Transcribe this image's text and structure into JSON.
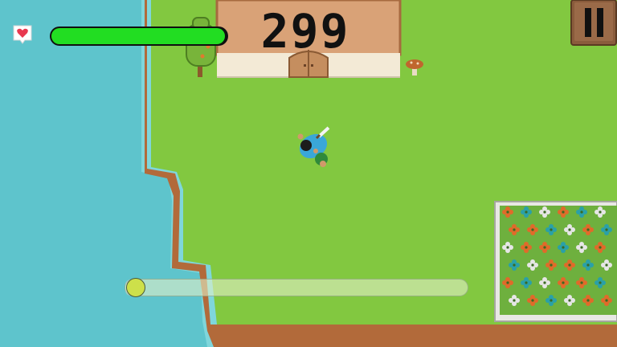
{
  "hud": {
    "score": "299",
    "health_fraction": 0.99,
    "progress_fraction": 0.03,
    "icons": {
      "health": "heart-icon",
      "pause": "pause-icon"
    }
  },
  "world": {
    "objects": [
      "house",
      "door",
      "tree",
      "mushroom",
      "player",
      "sword",
      "flower-garden",
      "ocean",
      "grass-island"
    ]
  },
  "colors": {
    "ocean": "#5ec4cc",
    "grass": "#82c840",
    "health_bar": "#22dd22",
    "heart": "#e8384f",
    "progress_knob": "#cde04a"
  }
}
